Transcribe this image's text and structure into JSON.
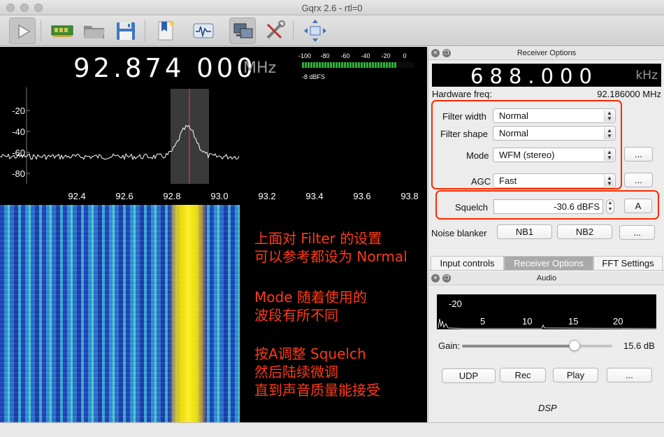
{
  "window": {
    "title": "Gqrx 2.6 - rtl=0"
  },
  "toolbar": {
    "buttons": [
      "play-icon",
      "device-icon",
      "open-folder-icon",
      "save-icon",
      "bookmark-icon",
      "fft-icon",
      "remote-control-icon",
      "tools-icon",
      "fullscreen-icon"
    ]
  },
  "main": {
    "frequency": "92.874 000",
    "frequency_unit": "MHz",
    "smeter": {
      "ticks": [
        "-100",
        "-80",
        "-60",
        "-40",
        "-20",
        "0"
      ],
      "reading": "-8 dBFS",
      "level_dbfs": -8
    },
    "spectrum": {
      "y_ticks": [
        "-20",
        "-40",
        "-60",
        "-80"
      ],
      "x_ticks": [
        "92.4",
        "92.6",
        "92.8",
        "93.0",
        "93.2",
        "93.4",
        "93.6",
        "93.8"
      ]
    },
    "annotations": [
      "上面对 Filter 的设置",
      "可以参考都设为 Normal",
      "Mode 随着使用的",
      "波段有所不同",
      "按A调整 Squelch",
      "然后陆续微调",
      "直到声音质量能接受"
    ]
  },
  "receiver": {
    "dock_title": "Receiver Options",
    "lcd_value": "688.000",
    "lcd_unit": "kHz",
    "hw_freq_label": "Hardware freq:",
    "hw_freq_value": "92.186000 MHz",
    "filter_width_label": "Filter width",
    "filter_width_value": "Normal",
    "filter_shape_label": "Filter shape",
    "filter_shape_value": "Normal",
    "mode_label": "Mode",
    "mode_value": "WFM (stereo)",
    "more_label": "...",
    "agc_label": "AGC",
    "agc_value": "Fast",
    "squelch_label": "Squelch",
    "squelch_value": "-30.6 dBFS",
    "squelch_auto": "A",
    "noise_blanker_label": "Noise blanker",
    "nb1": "NB1",
    "nb2": "NB2"
  },
  "tabs": [
    "Input controls",
    "Receiver Options",
    "FFT Settings"
  ],
  "audio": {
    "dock_title": "Audio",
    "y_tick": "-20",
    "x_ticks": [
      "5",
      "10",
      "15",
      "20"
    ],
    "gain_label": "Gain:",
    "gain_value": "15.6 dB",
    "gain_fraction": 0.75,
    "buttons": [
      "UDP",
      "Rec",
      "Play",
      "..."
    ],
    "footer": "DSP"
  },
  "colors": {
    "annotation": "#ff3a1a",
    "highlight_box": "#ff2a00",
    "tuning_line": "#ff3b3b",
    "smeter_fill": "#2fae3a"
  }
}
